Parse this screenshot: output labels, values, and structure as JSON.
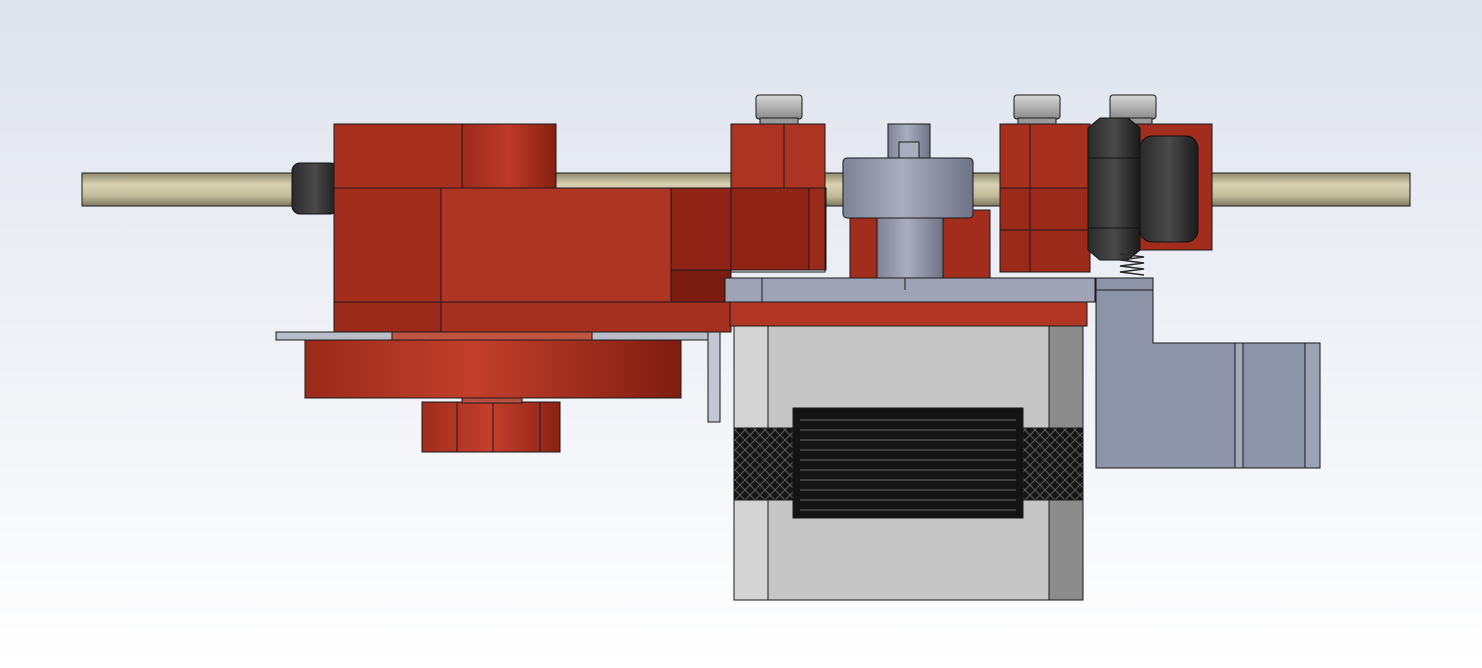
{
  "scene": {
    "view": "cad-assembly-front-view",
    "parts": [
      "guide-rod",
      "red-extruder-body",
      "red-idler-arm",
      "red-lower-gear-disc",
      "red-thumb-knob",
      "steel-mounting-bracket",
      "socket-head-screws",
      "red-rod-clamp-blocks",
      "drive-gear-hub",
      "stepper-motor",
      "motor-label-sticker",
      "hex-nut-assembly",
      "idler-spring",
      "grey-side-bracket"
    ]
  },
  "colors": {
    "background_top": "#dfe3ee",
    "background_bottom": "#ffffff",
    "red": "#a8301f",
    "red_light": "#c23f2c",
    "red_dark": "#861f12",
    "rod": "#c9c3a3",
    "rod_shade": "#8e8a6e",
    "steel": "#8f95a8",
    "steel_light": "#b8bdcc",
    "motor_body": "#c4c4c4",
    "motor_dark": "#7d7d7d",
    "black": "#1b1b1b",
    "outline": "#1a1a1a"
  }
}
